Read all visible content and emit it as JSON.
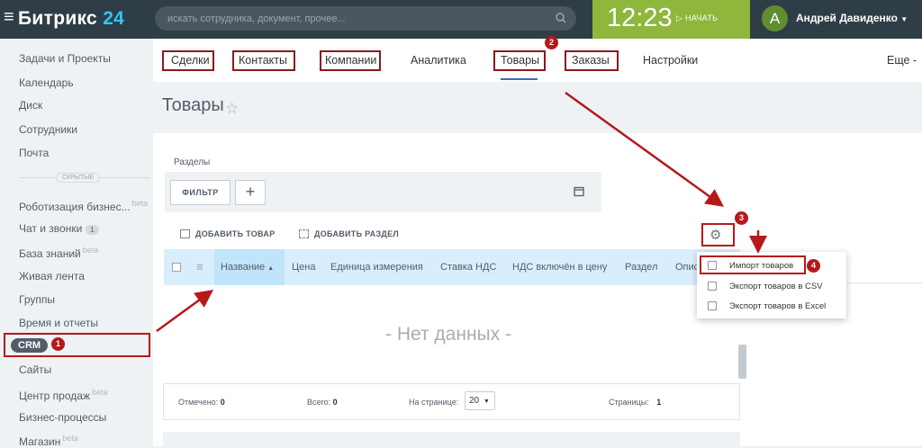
{
  "header": {
    "logo_main": "Битрикс",
    "logo_num": "24",
    "search_placeholder": "искать сотрудника, документ, прочее...",
    "time": "12:23",
    "start_label": "НАЧАТЬ",
    "avatar_letter": "А",
    "user_name": "Андрей Давиденко"
  },
  "sidebar": {
    "items": [
      "Задачи и Проекты",
      "Календарь",
      "Диск",
      "Сотрудники",
      "Почта"
    ],
    "hidden_label": "СКРЫТЫЕ",
    "hidden_items": [
      {
        "label": "Роботизация бизнес...",
        "sup": "beta"
      },
      {
        "label": "Чат и звонки",
        "badge": "1"
      },
      {
        "label": "База знаний",
        "sup": "beta"
      },
      {
        "label": "Живая лента"
      },
      {
        "label": "Группы"
      },
      {
        "label": "Время и отчеты"
      },
      {
        "label": "CRM"
      },
      {
        "label": "Сайты"
      },
      {
        "label": "Центр продаж",
        "sup": "beta"
      },
      {
        "label": "Бизнес-процессы"
      },
      {
        "label": "Магазин",
        "sup": "beta"
      }
    ]
  },
  "tabs": {
    "items": [
      "Сделки",
      "Контакты",
      "Компании",
      "Аналитика",
      "Товары",
      "Заказы",
      "Настройки"
    ],
    "more": "Еще -"
  },
  "page": {
    "title": "Товары",
    "sections_label": "Разделы",
    "filter_label": "ФИЛЬТР",
    "plus": "+",
    "add_product": "ДОБАВИТЬ ТОВАР",
    "add_section": "ДОБАВИТЬ РАЗДЕЛ",
    "columns": [
      "Название",
      "Цена",
      "Единица измерения",
      "Ставка НДС",
      "НДС включён в цену",
      "Раздел",
      "Опис"
    ],
    "no_data": "- Нет данных -",
    "footer": {
      "selected_label": "Отмечено:",
      "selected": "0",
      "total_label": "Всего:",
      "total": "0",
      "per_page_label": "На странице:",
      "per_page": "20",
      "pages_label": "Страницы:",
      "pages": "1"
    }
  },
  "dropdown": [
    "Импорт товаров",
    "Экспорт товаров в CSV",
    "Экспорт товаров в Excel"
  ],
  "annotations": [
    "1",
    "2",
    "3",
    "4"
  ],
  "colors": {
    "annotation": "#b5191c",
    "topbar": "#2f3d47",
    "clock_bg": "#8eb73c",
    "header_row": "#d9eefc"
  }
}
